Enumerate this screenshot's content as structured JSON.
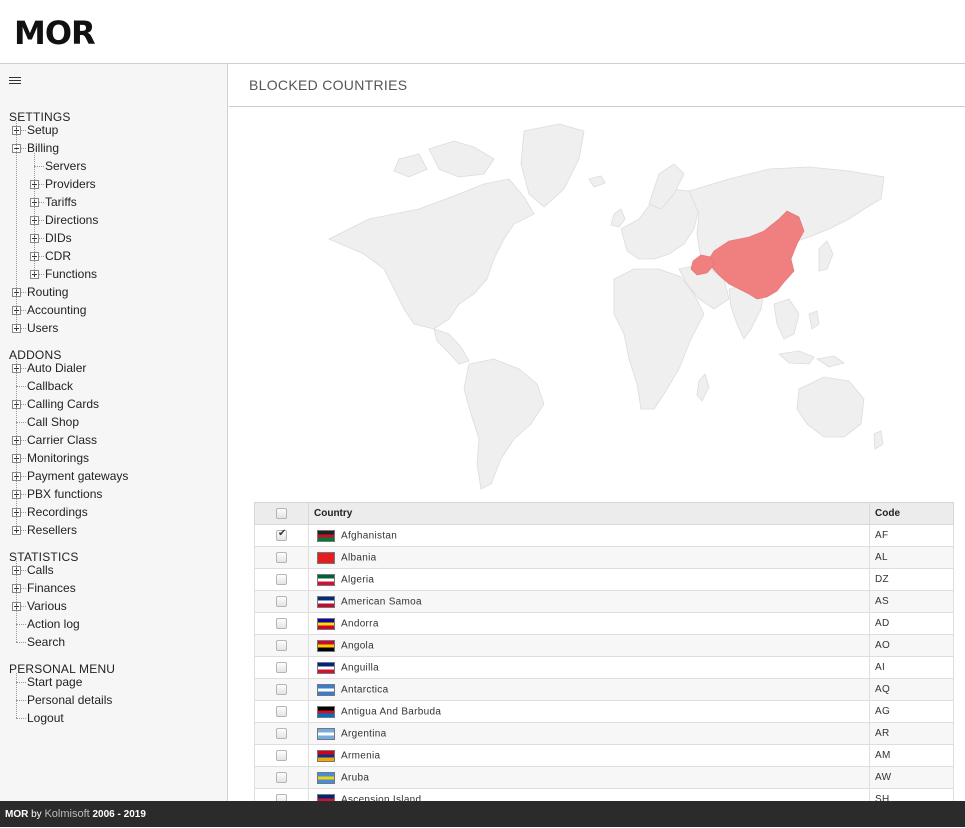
{
  "header": {
    "logo": "MOR"
  },
  "sidebar": {
    "sections": [
      {
        "title": "SETTINGS",
        "items": [
          {
            "label": "Setup",
            "expander": "plus"
          },
          {
            "label": "Billing",
            "expander": "minus",
            "children": [
              {
                "label": "Servers",
                "expander": "none"
              },
              {
                "label": "Providers",
                "expander": "plus"
              },
              {
                "label": "Tariffs",
                "expander": "plus"
              },
              {
                "label": "Directions",
                "expander": "plus"
              },
              {
                "label": "DIDs",
                "expander": "plus"
              },
              {
                "label": "CDR",
                "expander": "plus"
              },
              {
                "label": "Functions",
                "expander": "plus"
              }
            ]
          },
          {
            "label": "Routing",
            "expander": "plus"
          },
          {
            "label": "Accounting",
            "expander": "plus"
          },
          {
            "label": "Users",
            "expander": "plus"
          }
        ]
      },
      {
        "title": "ADDONS",
        "items": [
          {
            "label": "Auto Dialer",
            "expander": "plus"
          },
          {
            "label": "Callback",
            "expander": "none"
          },
          {
            "label": "Calling Cards",
            "expander": "plus"
          },
          {
            "label": "Call Shop",
            "expander": "none"
          },
          {
            "label": "Carrier Class",
            "expander": "plus"
          },
          {
            "label": "Monitorings",
            "expander": "plus"
          },
          {
            "label": "Payment gateways",
            "expander": "plus"
          },
          {
            "label": "PBX functions",
            "expander": "plus"
          },
          {
            "label": "Recordings",
            "expander": "plus"
          },
          {
            "label": "Resellers",
            "expander": "plus"
          }
        ]
      },
      {
        "title": "STATISTICS",
        "items": [
          {
            "label": "Calls",
            "expander": "plus"
          },
          {
            "label": "Finances",
            "expander": "plus"
          },
          {
            "label": "Various",
            "expander": "plus"
          },
          {
            "label": "Action log",
            "expander": "none"
          },
          {
            "label": "Search",
            "expander": "none"
          }
        ]
      },
      {
        "title": "PERSONAL MENU",
        "items": [
          {
            "label": "Start page",
            "expander": "none"
          },
          {
            "label": "Personal details",
            "expander": "none"
          },
          {
            "label": "Logout",
            "expander": "none"
          }
        ]
      }
    ]
  },
  "main": {
    "title": "BLOCKED COUNTRIES",
    "map": {
      "blocked_color": "#f08080",
      "land_color": "#efefef",
      "blocked_countries": [
        "CN",
        "AF"
      ]
    },
    "table": {
      "headers": {
        "country": "Country",
        "code": "Code"
      },
      "rows": [
        {
          "country": "Afghanistan",
          "code": "AF",
          "checked": true,
          "flag": [
            "#222222",
            "#c8102e",
            "#007a36"
          ]
        },
        {
          "country": "Albania",
          "code": "AL",
          "checked": false,
          "flag": [
            "#e41e20",
            "#e41e20",
            "#e41e20"
          ]
        },
        {
          "country": "Algeria",
          "code": "DZ",
          "checked": false,
          "flag": [
            "#006233",
            "#ffffff",
            "#d21034"
          ]
        },
        {
          "country": "American Samoa",
          "code": "AS",
          "checked": false,
          "flag": [
            "#002b7f",
            "#ffffff",
            "#bf0a30"
          ]
        },
        {
          "country": "Andorra",
          "code": "AD",
          "checked": false,
          "flag": [
            "#10069f",
            "#fedd00",
            "#d50032"
          ]
        },
        {
          "country": "Angola",
          "code": "AO",
          "checked": false,
          "flag": [
            "#cc092f",
            "#ffcb00",
            "#000000"
          ]
        },
        {
          "country": "Anguilla",
          "code": "AI",
          "checked": false,
          "flag": [
            "#00247d",
            "#ffffff",
            "#cf142b"
          ]
        },
        {
          "country": "Antarctica",
          "code": "AQ",
          "checked": false,
          "flag": [
            "#3a7dce",
            "#ffffff",
            "#3a7dce"
          ]
        },
        {
          "country": "Antigua And Barbuda",
          "code": "AG",
          "checked": false,
          "flag": [
            "#000000",
            "#ce1126",
            "#0072c6"
          ]
        },
        {
          "country": "Argentina",
          "code": "AR",
          "checked": false,
          "flag": [
            "#74acdf",
            "#ffffff",
            "#74acdf"
          ]
        },
        {
          "country": "Armenia",
          "code": "AM",
          "checked": false,
          "flag": [
            "#d90012",
            "#0033a0",
            "#f2a800"
          ]
        },
        {
          "country": "Aruba",
          "code": "AW",
          "checked": false,
          "flag": [
            "#418fde",
            "#ffd100",
            "#418fde"
          ]
        },
        {
          "country": "Ascension Island",
          "code": "SH",
          "checked": false,
          "flag": [
            "#00247d",
            "#cf142b",
            "#00247d"
          ]
        }
      ]
    }
  },
  "footer": {
    "brand": "MOR",
    "by": "by",
    "company": "Kolmisoft",
    "years": "2006 - 2019"
  }
}
